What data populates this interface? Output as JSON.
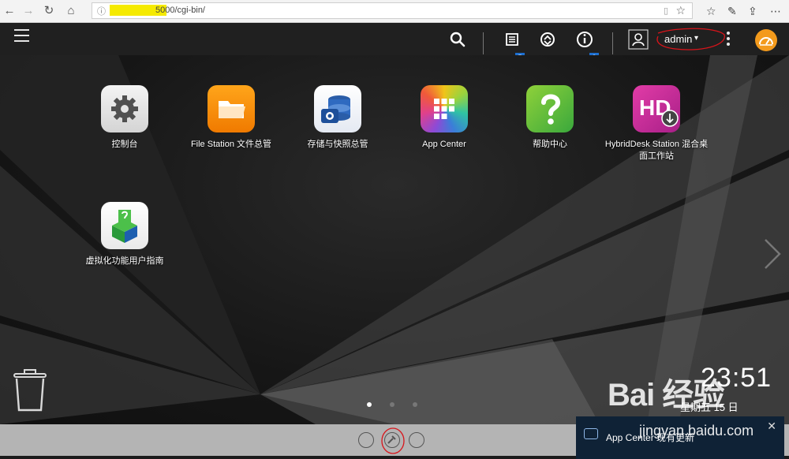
{
  "browser": {
    "url_visible": "5000/cgi-bin/",
    "url_highlighted": true
  },
  "topbar": {
    "task_badge": "5",
    "info_badge": "2",
    "user_name": "admin",
    "user_caret": "▾"
  },
  "desktop": {
    "apps": [
      {
        "label": "控制台",
        "icon": "gear-icon"
      },
      {
        "label": "File Station 文件总管",
        "icon": "folder-icon"
      },
      {
        "label": "存储与快照总管",
        "icon": "storage-icon"
      },
      {
        "label": "App Center",
        "icon": "app-center-icon"
      },
      {
        "label": "帮助中心",
        "icon": "help-icon"
      },
      {
        "label": "HybridDesk Station 混合桌面工作站",
        "icon": "hybriddesk-icon"
      },
      {
        "label": "虚拟化功能用户指南",
        "icon": "virtualization-guide-icon"
      }
    ],
    "page_count": 3,
    "active_page": 1
  },
  "clock": {
    "time": "23:51",
    "date": "星期五 15 日"
  },
  "notification": {
    "text": "App Center 现有更新"
  },
  "watermark": {
    "text": "Bai 经验",
    "sub": "jingyan.baidu.com"
  },
  "colors": {
    "topbar_bg": "#202020",
    "dock_bg": "#b4b4b4",
    "badge": "#1d6fd0",
    "notify_bg": "#0f2236",
    "annotation_red": "#d8141a"
  }
}
